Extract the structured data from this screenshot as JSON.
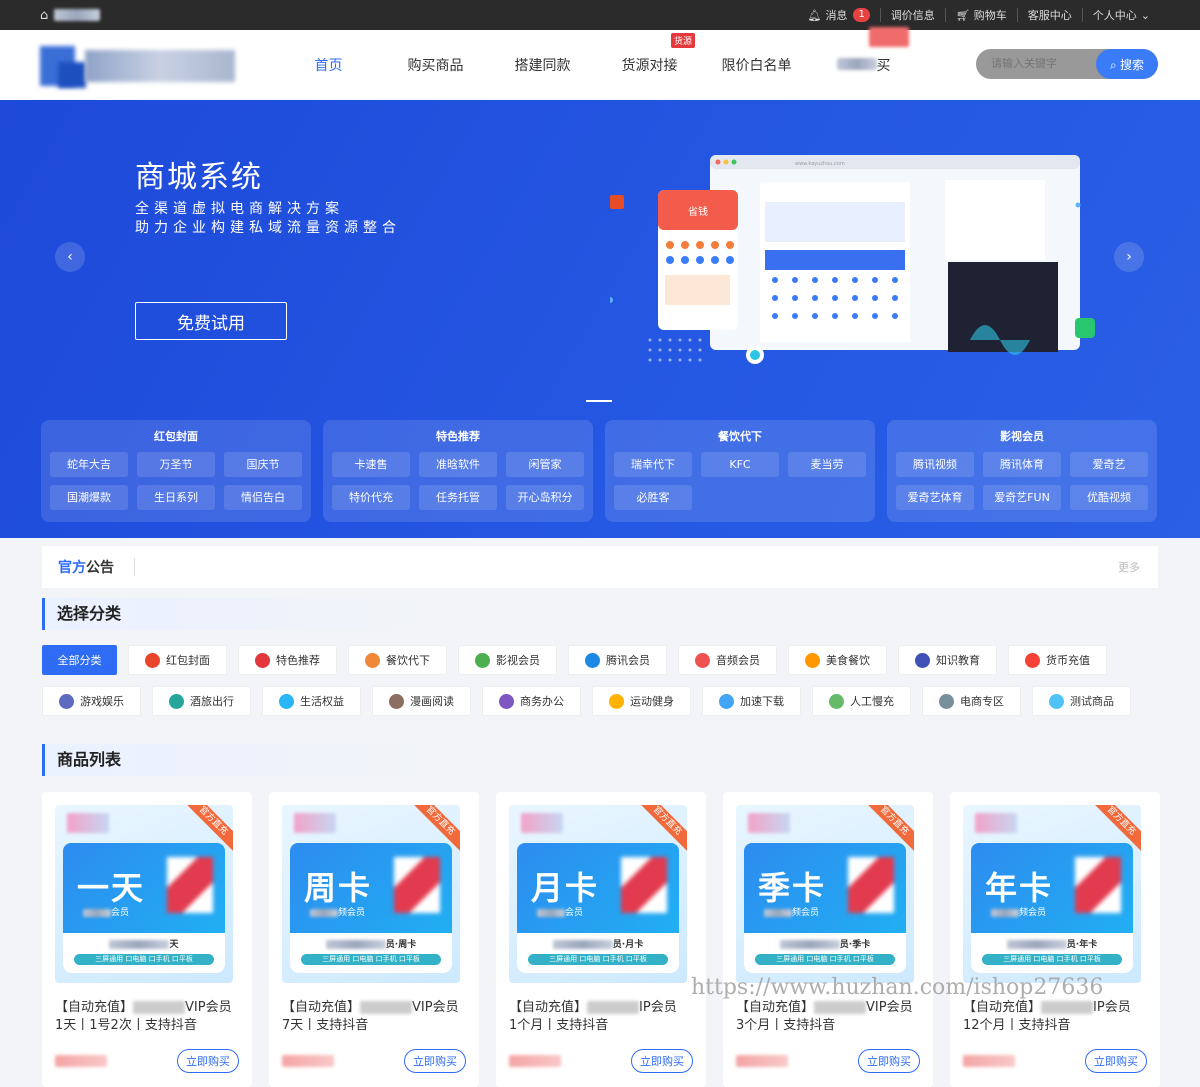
{
  "topbar": {
    "items": [
      {
        "label": "消息",
        "badge": "1"
      },
      {
        "label": "调价信息"
      },
      {
        "label": "购物车"
      },
      {
        "label": "客服中心"
      },
      {
        "label": "个人中心"
      }
    ]
  },
  "nav": {
    "items": [
      "首页",
      "购买商品",
      "搭建同款",
      "货源对接",
      "限价白名单",
      "便"
    ],
    "hot_label": "货源",
    "last_suffix": "买"
  },
  "search": {
    "placeholder": "请输入关键字",
    "button": "搜索"
  },
  "banner": {
    "title": "商城系统",
    "line1": "全渠道虚拟电商解决方案",
    "line2": "助力企业构建私域流量资源整合",
    "cta": "免费试用",
    "mock_url": "www.kayuzhou.com",
    "mock_promo": "省钱"
  },
  "category_boxes": [
    {
      "title": "红包封面",
      "items": [
        "蛇年大吉",
        "万圣节",
        "国庆节",
        "国潮爆款",
        "生日系列",
        "情侣告白"
      ]
    },
    {
      "title": "特色推荐",
      "items": [
        "卡速售",
        "准晗软件",
        "闲管家",
        "特价代充",
        "任务托管",
        "开心岛积分"
      ]
    },
    {
      "title": "餐饮代下",
      "items": [
        "瑞幸代下",
        "KFC",
        "麦当劳",
        "必胜客"
      ]
    },
    {
      "title": "影视会员",
      "items": [
        "腾讯视频",
        "腾讯体育",
        "爱奇艺",
        "爱奇艺体育",
        "爱奇艺FUN",
        "优酷视频"
      ]
    }
  ],
  "notice": {
    "title_a": "官方",
    "title_b": "公告",
    "more": "更多"
  },
  "select_category": {
    "title": "选择分类",
    "chips": [
      {
        "label": "全部分类",
        "active": true
      },
      {
        "label": "红包封面",
        "color": "#e8452c"
      },
      {
        "label": "特色推荐",
        "color": "#e4393c"
      },
      {
        "label": "餐饮代下",
        "color": "#f0883a"
      },
      {
        "label": "影视会员",
        "color": "#4caf50"
      },
      {
        "label": "腾讯会员",
        "color": "#1e88e5"
      },
      {
        "label": "音频会员",
        "color": "#ef5350"
      },
      {
        "label": "美食餐饮",
        "color": "#ff9800"
      },
      {
        "label": "知识教育",
        "color": "#3f51b5"
      },
      {
        "label": "货币充值",
        "color": "#f44336"
      },
      {
        "label": "游戏娱乐",
        "color": "#5c6bc0"
      },
      {
        "label": "酒旅出行",
        "color": "#26a69a"
      },
      {
        "label": "生活权益",
        "color": "#29b6f6"
      },
      {
        "label": "漫画阅读",
        "color": "#8d6e63"
      },
      {
        "label": "商务办公",
        "color": "#7e57c2"
      },
      {
        "label": "运动健身",
        "color": "#ffb300"
      },
      {
        "label": "加速下载",
        "color": "#42a5f5"
      },
      {
        "label": "人工慢充",
        "color": "#66bb6a"
      },
      {
        "label": "电商专区",
        "color": "#78909c"
      },
      {
        "label": "测试商品",
        "color": "#4fc3f7"
      }
    ]
  },
  "product_list": {
    "title": "商品列表",
    "ribbon": "官方直充",
    "strip_tags": "三屏通用 口电脑 口手机 口平板",
    "buy_label": "立即购买",
    "products": [
      {
        "big": "一天",
        "badge_text": "会员",
        "strip": "天",
        "title_a": "【自动充值】",
        "title_b": "VIP会员",
        "desc": "1天丨1号2次丨支持抖音"
      },
      {
        "big": "周卡",
        "badge_text": "频会员",
        "strip": "员·周卡",
        "title_a": "【自动充值】",
        "title_b": "VIP会员",
        "desc": "7天丨支持抖音"
      },
      {
        "big": "月卡",
        "badge_text": "会员",
        "strip": "员·月卡",
        "title_a": "【自动充值】",
        "title_b": "IP会员",
        "desc": "1个月丨支持抖音"
      },
      {
        "big": "季卡",
        "badge_text": "频会员",
        "strip": "员·季卡",
        "title_a": "【自动充值】",
        "title_b": "VIP会员",
        "desc": "3个月丨支持抖音"
      },
      {
        "big": "年卡",
        "badge_text": "频会员",
        "strip": "员·年卡",
        "title_a": "【自动充值】",
        "title_b": "IP会员",
        "desc": "12个月丨支持抖音"
      }
    ]
  },
  "watermark": "https://www.huzhan.com/ishop27636"
}
